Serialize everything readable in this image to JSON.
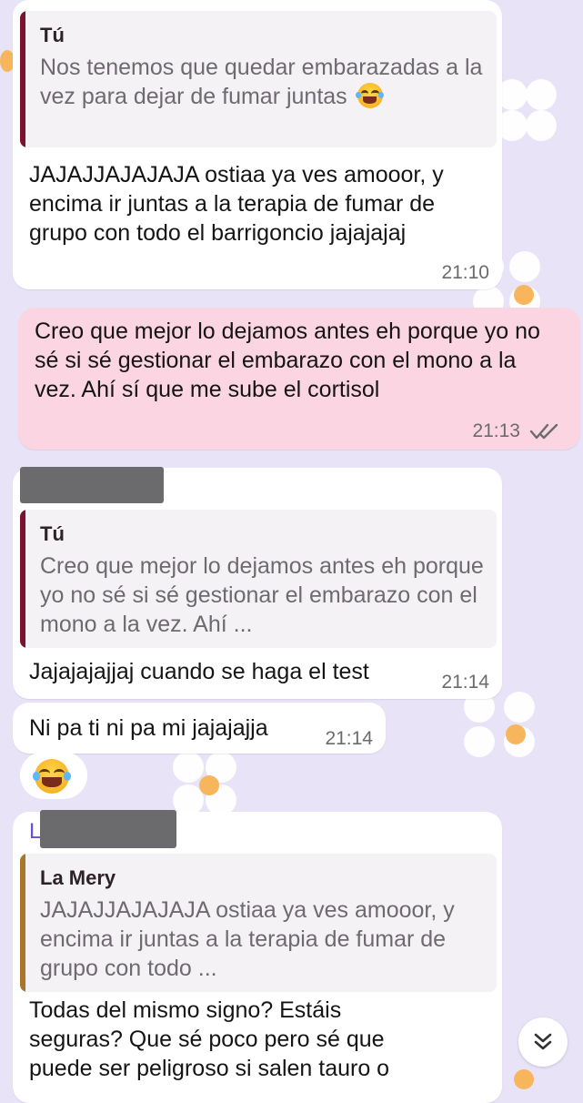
{
  "messages": [
    {
      "quote_author": "Tú",
      "quote_text": "Nos tenemos que quedar embarazadas a la vez para dejar de fumar juntas",
      "text": "JAJAJJAJAJAJA ostiaa ya ves amooor, y encima ir juntas a la terapia de fumar de grupo con todo el barrigoncio jajajajaj",
      "time": "21:10"
    },
    {
      "text": "Creo que mejor lo dejamos antes eh porque yo no sé si sé gestionar el embarazo con el mono a la vez. Ahí sí que me sube el cortisol",
      "time": "21:13"
    },
    {
      "quote_author": "Tú",
      "quote_text": "Creo que mejor lo dejamos antes eh porque yo no sé si sé gestionar el embarazo con el mono a la vez. Ahí ...",
      "text": "Jajajajajjaj cuando se haga el test",
      "time": "21:14"
    },
    {
      "text": "Ni pa ti ni pa mi jajajajja",
      "time": "21:14"
    },
    {
      "sender_initial": "L",
      "quote_author": "La Mery",
      "quote_text": "JAJAJJAJAJAJA ostiaa ya ves amooor, y encima ir juntas a la terapia de fumar de grupo con todo ...",
      "text": "Todas del mismo signo? Estáis seguras? Que sé poco pero sé que puede ser peligroso si salen tauro o"
    }
  ],
  "colors": {
    "background": "#e9e3f8",
    "incoming_bubble": "#ffffff",
    "outgoing_bubble": "#fbd5e2",
    "quote_bar_self": "#7a1230",
    "quote_bar_other": "#a8772c",
    "sender_name": "#6a4fd0"
  },
  "icons": {
    "laugh_emoji": "face-with-tears-of-joy",
    "read_receipt": "double-check",
    "scroll_down": "double-chevron-down"
  }
}
